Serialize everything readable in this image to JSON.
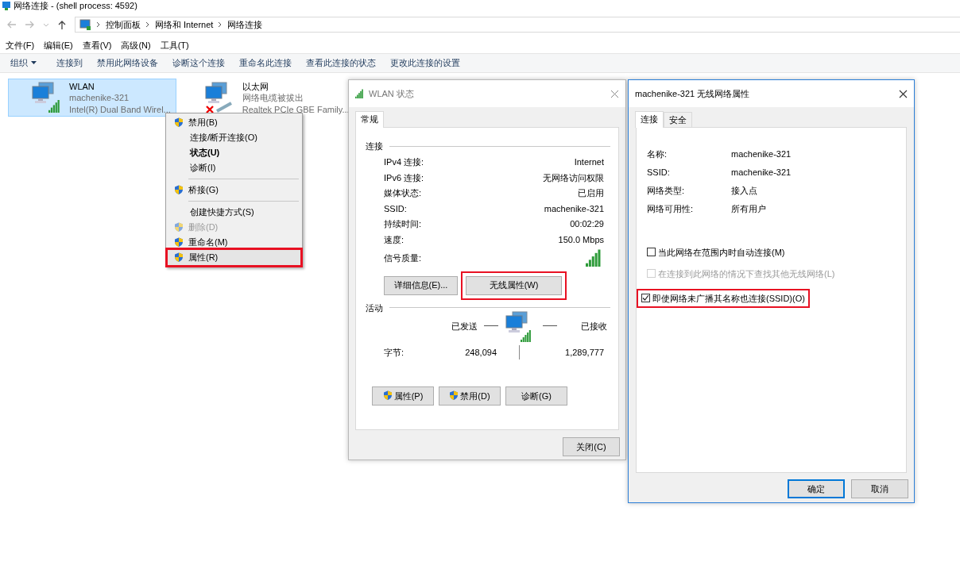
{
  "explorer": {
    "title": "网络连接 - (shell process: 4592)",
    "breadcrumb": [
      "控制面板",
      "网络和 Internet",
      "网络连接"
    ],
    "menu": [
      "文件(F)",
      "编辑(E)",
      "查看(V)",
      "高级(N)",
      "工具(T)"
    ],
    "toolbar": [
      {
        "label": "组织",
        "dropdown": true
      },
      {
        "label": "连接到",
        "dropdown": false
      },
      {
        "label": "禁用此网络设备",
        "dropdown": false
      },
      {
        "label": "诊断这个连接",
        "dropdown": false
      },
      {
        "label": "重命名此连接",
        "dropdown": false
      },
      {
        "label": "查看此连接的状态",
        "dropdown": false
      },
      {
        "label": "更改此连接的设置",
        "dropdown": false
      }
    ],
    "adapters": [
      {
        "name": "WLAN",
        "status": "machenike-321",
        "device": "Intel(R) Dual Band Wirel...",
        "selected": true,
        "connected": true
      },
      {
        "name": "以太网",
        "status": "网络电缆被拔出",
        "device": "Realtek PCIe GBE Family...",
        "selected": false,
        "connected": false
      }
    ]
  },
  "context_menu": {
    "items": [
      {
        "kind": "item",
        "label": "禁用(B)",
        "shield": true,
        "disabled": false,
        "default": false,
        "highlighted": false
      },
      {
        "kind": "item",
        "label": "连接/断开连接(O)",
        "shield": false,
        "disabled": false,
        "default": false,
        "highlighted": false
      },
      {
        "kind": "item",
        "label": "状态(U)",
        "shield": false,
        "disabled": false,
        "default": true,
        "highlighted": false
      },
      {
        "kind": "item",
        "label": "诊断(I)",
        "shield": false,
        "disabled": false,
        "default": false,
        "highlighted": false
      },
      {
        "kind": "separator"
      },
      {
        "kind": "item",
        "label": "桥接(G)",
        "shield": true,
        "disabled": false,
        "default": false,
        "highlighted": false
      },
      {
        "kind": "separator"
      },
      {
        "kind": "item",
        "label": "创建快捷方式(S)",
        "shield": false,
        "disabled": false,
        "default": false,
        "highlighted": false
      },
      {
        "kind": "item",
        "label": "删除(D)",
        "shield": true,
        "disabled": true,
        "default": false,
        "highlighted": false
      },
      {
        "kind": "item",
        "label": "重命名(M)",
        "shield": true,
        "disabled": false,
        "default": false,
        "highlighted": false
      },
      {
        "kind": "item",
        "label": "属性(R)",
        "shield": true,
        "disabled": false,
        "default": false,
        "highlighted": true
      }
    ]
  },
  "status_dialog": {
    "title": "WLAN 状态",
    "tabs": [
      {
        "label": "常规",
        "selected": true
      }
    ],
    "connection_heading": "连接",
    "fields": [
      {
        "kind": "text",
        "label": "IPv4 连接:",
        "value": "Internet"
      },
      {
        "kind": "text",
        "label": "IPv6 连接:",
        "value": "无网络访问权限"
      },
      {
        "kind": "text",
        "label": "媒体状态:",
        "value": "已启用"
      },
      {
        "kind": "text",
        "label": "SSID:",
        "value": "machenike-321"
      },
      {
        "kind": "text",
        "label": "持续时间:",
        "value": "00:02:29"
      },
      {
        "kind": "text",
        "label": "速度:",
        "value": "150.0 Mbps"
      },
      {
        "kind": "signal",
        "label": "信号质量:"
      }
    ],
    "detail_buttons": [
      {
        "label": "详细信息(E)...",
        "highlighted": false
      },
      {
        "label": "无线属性(W)",
        "highlighted": true
      }
    ],
    "activity_heading": "活动",
    "sent_label": "已发送",
    "received_label": "已接收",
    "bytes_label": "字节:",
    "bytes_sent": "248,094",
    "bytes_received": "1,289,777",
    "action_buttons": [
      {
        "label": "属性(P)",
        "shield": true
      },
      {
        "label": "禁用(D)",
        "shield": true
      },
      {
        "label": "诊断(G)",
        "shield": false
      }
    ],
    "close_button": "关闭(C)"
  },
  "properties_dialog": {
    "title": "machenike-321 无线网络属性",
    "tabs": [
      {
        "label": "连接",
        "selected": true
      },
      {
        "label": "安全",
        "selected": false
      }
    ],
    "fields": [
      {
        "label": "名称:",
        "value": "machenike-321"
      },
      {
        "label": "SSID:",
        "value": "machenike-321"
      },
      {
        "label": "网络类型:",
        "value": "接入点"
      },
      {
        "label": "网络可用性:",
        "value": "所有用户"
      }
    ],
    "checkboxes": [
      {
        "label": "当此网络在范围内时自动连接(M)",
        "checked": false,
        "disabled": false,
        "highlighted": false
      },
      {
        "label": "在连接到此网络的情况下查找其他无线网络(L)",
        "checked": false,
        "disabled": true,
        "highlighted": false
      },
      {
        "label": "即使网络未广播其名称也连接(SSID)(O)",
        "checked": true,
        "disabled": false,
        "highlighted": true
      }
    ],
    "buttons": [
      {
        "label": "确定",
        "default": true
      },
      {
        "label": "取消",
        "default": false
      }
    ]
  }
}
